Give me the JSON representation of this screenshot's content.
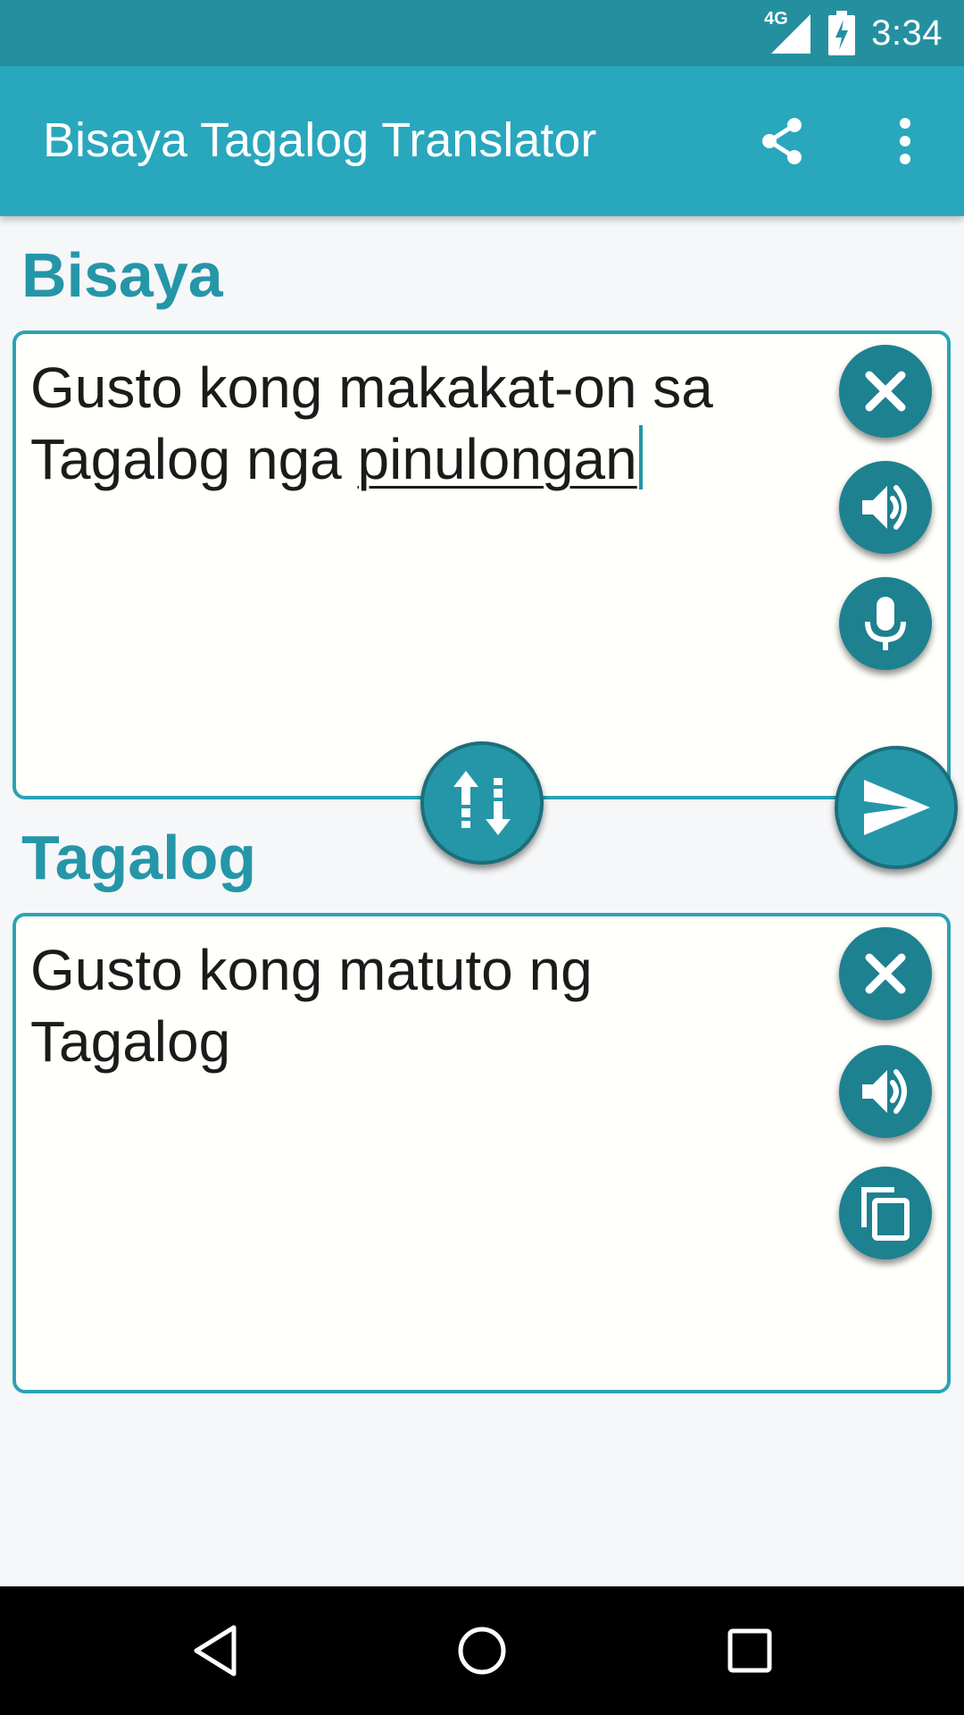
{
  "status_bar": {
    "network": "4G",
    "time": "3:34"
  },
  "app_bar": {
    "title": "Bisaya Tagalog Translator",
    "icons": [
      "share-icon",
      "overflow-menu-icon"
    ]
  },
  "source": {
    "language_label": "Bisaya",
    "text_plain": "Gusto kong makakat-on sa Tagalog nga ",
    "text_composing": "pinulongan",
    "actions": [
      "clear-icon",
      "speaker-icon",
      "microphone-icon"
    ]
  },
  "middle_actions": [
    "swap-languages-icon",
    "send-translate-icon"
  ],
  "target": {
    "language_label": "Tagalog",
    "text": "Gusto kong matuto ng Tagalog",
    "actions": [
      "clear-icon",
      "speaker-icon",
      "copy-icon"
    ]
  },
  "nav_bar": {
    "buttons": [
      "back-icon",
      "home-icon",
      "recents-icon"
    ]
  },
  "colors": {
    "status_bar": "#24909f",
    "app_bar": "#29a7bd",
    "accent": "#2596a8",
    "fab": "#1d8190"
  }
}
